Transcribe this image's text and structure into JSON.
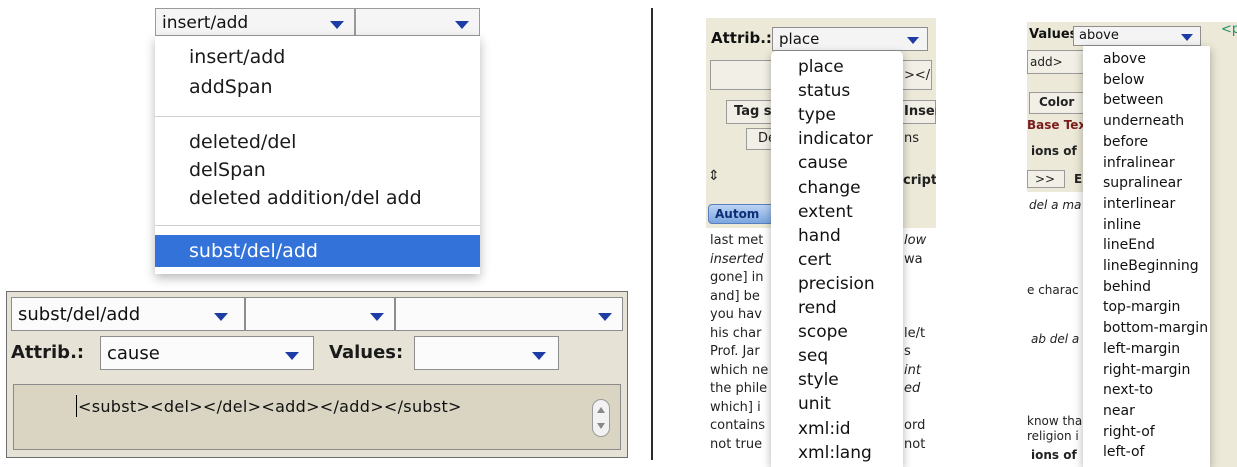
{
  "panel1": {
    "combo_selected": "insert/add",
    "menu_items": [
      "insert/add",
      "addSpan",
      "deleted/del",
      "delSpan",
      "deleted addition/del add",
      "subst/del/add"
    ],
    "selected_index": 5
  },
  "panel2": {
    "combo1": "subst/del/add",
    "combo2": "",
    "combo3": "",
    "attrib_label": "Attrib.:",
    "attrib_value": "cause",
    "values_label": "Values:",
    "values_value": "",
    "editor_text": "<subst><del></del><add></add></subst>"
  },
  "panel3": {
    "attrib_label": "Attrib.:",
    "attrib_value": "place",
    "bg_fragments": {
      "tag_btn": "Tag s",
      "insert_btn": "Insert tag",
      "de_btn": "De",
      "ns_btn": "ns",
      "descr": "cript",
      "autom_tab": "Autom",
      "tag_close": "></"
    },
    "text_lines": [
      "last met",
      "inserted",
      "gone] in",
      "and] be",
      "you hav",
      "his char",
      "Prof. Jar",
      "which ne",
      "the phile",
      "which] i",
      "contains",
      "not true"
    ],
    "right_fragments": [
      "low",
      "wa",
      "",
      "",
      "",
      "le/t",
      "s",
      "int",
      "ed",
      "",
      "ord",
      "not"
    ],
    "menu_items": [
      "place",
      "status",
      "type",
      "indicator",
      "cause",
      "change",
      "extent",
      "hand",
      "cert",
      "precision",
      "rend",
      "scope",
      "seq",
      "style",
      "unit",
      "xml:id",
      "xml:lang"
    ]
  },
  "panel4": {
    "values_label": "Values:",
    "values_value": "above",
    "green_text": "<p",
    "bg_fragments": {
      "add_tag": "add>",
      "color_btn": "Color",
      "base_text": "Base Tex",
      "ions_of": "ions of",
      "nav": ">>",
      "nav_e": "E",
      "del_a": "del a ma",
      "charac": "e charac",
      "ab_del": "ab del a",
      "know_tha": "know tha",
      "religion": "religion i",
      "ions_bottom": "ions of"
    },
    "menu_items": [
      "above",
      "below",
      "between",
      "underneath",
      "before",
      "infralinear",
      "supralinear",
      "interlinear",
      "inline",
      "lineEnd",
      "lineBeginning",
      "behind",
      "top-margin",
      "bottom-margin",
      "left-margin",
      "right-margin",
      "next-to",
      "near",
      "right-of",
      "left-of"
    ]
  },
  "colors": {
    "chevron": "#1e3ca6",
    "selection": "#3272d9",
    "panel_bg": "#e6e3d6"
  }
}
